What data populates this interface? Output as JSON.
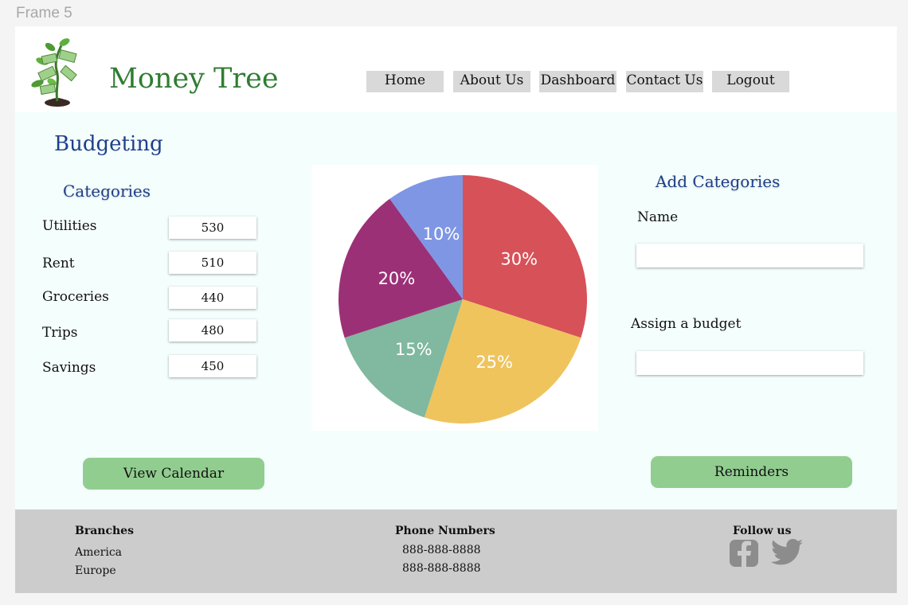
{
  "frame_label": "Frame 5",
  "header": {
    "brand": "Money Tree",
    "nav": [
      {
        "label": "Home"
      },
      {
        "label": "About Us"
      },
      {
        "label": "Dashboard"
      },
      {
        "label": "Contact Us"
      },
      {
        "label": "Logout"
      }
    ]
  },
  "main": {
    "title": "Budgeting",
    "categories_title": "Categories",
    "categories": [
      {
        "label": "Utilities",
        "value": "530"
      },
      {
        "label": "Rent",
        "value": "510"
      },
      {
        "label": "Groceries",
        "value": "440"
      },
      {
        "label": "Trips",
        "value": "480"
      },
      {
        "label": "Savings",
        "value": "450"
      }
    ],
    "add_title": "Add Categories",
    "name_label": "Name",
    "budget_label": "Assign a budget",
    "view_calendar": "View Calendar",
    "reminders": "Reminders"
  },
  "chart_data": {
    "type": "pie",
    "slices": [
      {
        "label": "30%",
        "value": 30,
        "color": "#d75159"
      },
      {
        "label": "25%",
        "value": 25,
        "color": "#efc45d"
      },
      {
        "label": "15%",
        "value": 15,
        "color": "#80b8a0"
      },
      {
        "label": "20%",
        "value": 20,
        "color": "#9c3077"
      },
      {
        "label": "10%",
        "value": 10,
        "color": "#7f96e4"
      }
    ]
  },
  "footer": {
    "branches_title": "Branches",
    "branches": [
      "America",
      "Europe"
    ],
    "phones_title": "Phone Numbers",
    "phones": [
      "888-888-8888",
      "888-888-8888"
    ],
    "follow_title": "Follow us"
  },
  "colors": {
    "brand_green": "#2f7d32",
    "title_blue": "#1f3f8a",
    "button_green": "#92cd90",
    "footer_gray": "#cccccc",
    "main_bg": "#f4fefd"
  },
  "icons": {
    "logo": "money-tree-logo",
    "social": [
      "facebook-icon",
      "twitter-icon"
    ]
  }
}
